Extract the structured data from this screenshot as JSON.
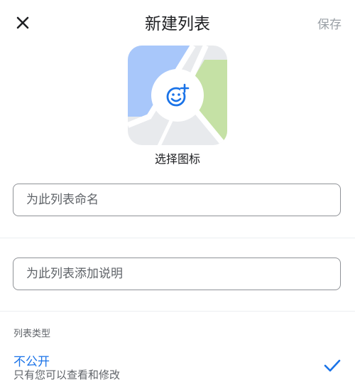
{
  "header": {
    "title": "新建列表",
    "save_label": "保存"
  },
  "icon_picker": {
    "label": "选择图标"
  },
  "form": {
    "name_placeholder": "为此列表命名",
    "description_placeholder": "为此列表添加说明"
  },
  "list_type": {
    "section_label": "列表类型",
    "selected_option": {
      "title": "不公开",
      "subtitle": "只有您可以查看和修改"
    }
  },
  "colors": {
    "accent": "#1a73e8",
    "map_blue": "#a8c7fa",
    "map_green": "#c5e1a5",
    "map_gray": "#e8eaed"
  }
}
